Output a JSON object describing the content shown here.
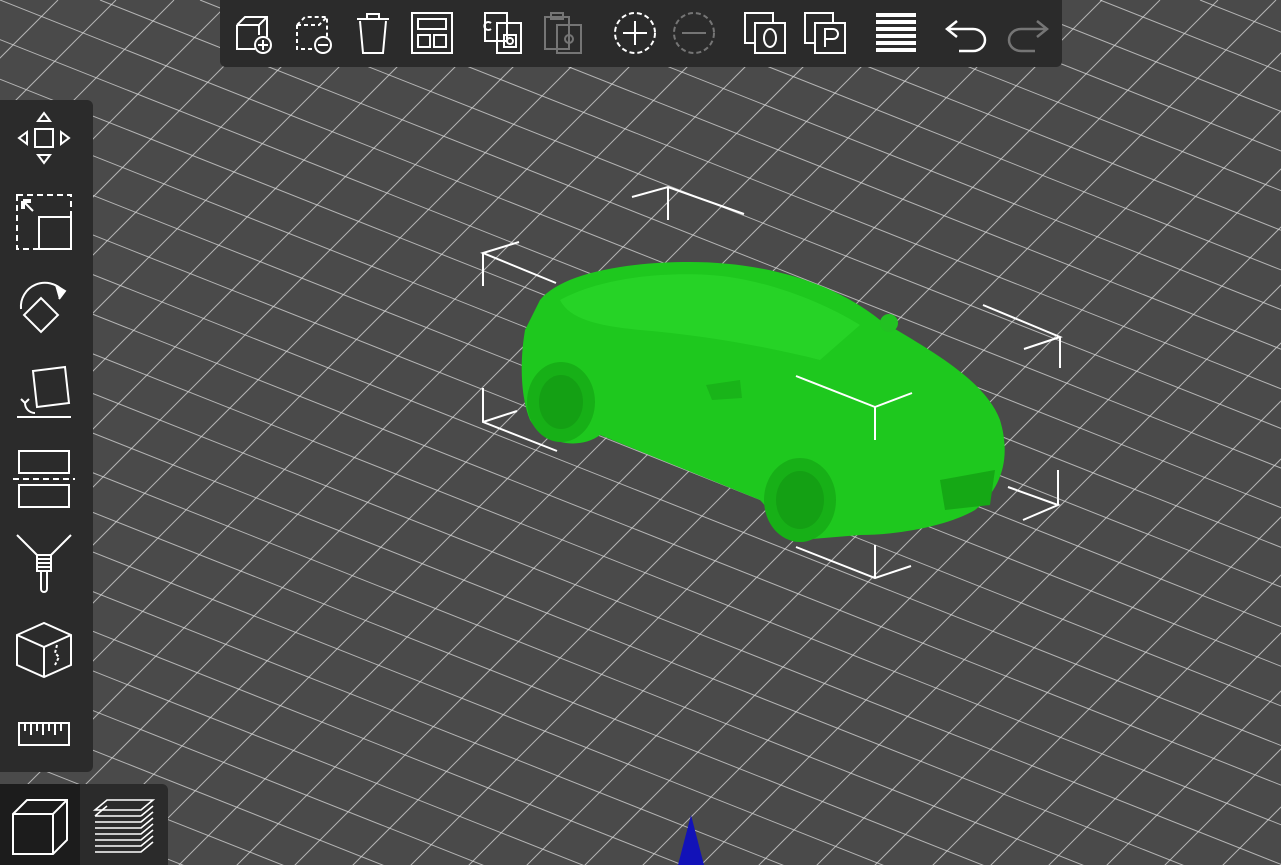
{
  "app": {
    "accent_model_color": "#1ec81e",
    "bed_color": "#4a4a4a",
    "grid_color": "#d8d8d8",
    "toolbar_bg": "#2b2b2b",
    "axis_marker_color": "#1212b8"
  },
  "top_toolbar": {
    "buttons": [
      {
        "icon": "add-object-icon",
        "enabled": true
      },
      {
        "icon": "remove-object-icon",
        "enabled": true
      },
      {
        "icon": "delete-icon",
        "enabled": true
      },
      {
        "icon": "arrange-icon",
        "enabled": true
      },
      {
        "icon": "copy-icon",
        "enabled": true
      },
      {
        "icon": "paste-icon",
        "enabled": false
      },
      {
        "icon": "add-instance-icon",
        "enabled": true
      },
      {
        "icon": "remove-instance-icon",
        "enabled": false
      },
      {
        "icon": "split-to-objects-icon",
        "enabled": true
      },
      {
        "icon": "split-to-parts-icon",
        "enabled": true
      },
      {
        "icon": "layers-editing-icon",
        "enabled": true
      },
      {
        "icon": "undo-icon",
        "enabled": true
      },
      {
        "icon": "redo-icon",
        "enabled": false
      }
    ]
  },
  "left_toolbar": {
    "tools": [
      {
        "icon": "move-icon"
      },
      {
        "icon": "scale-icon"
      },
      {
        "icon": "rotate-icon"
      },
      {
        "icon": "place-on-face-icon"
      },
      {
        "icon": "cut-icon"
      },
      {
        "icon": "paint-supports-icon"
      },
      {
        "icon": "seam-painting-icon"
      },
      {
        "icon": "measure-icon"
      }
    ]
  },
  "view_toggle": {
    "items": [
      {
        "icon": "3d-view-icon",
        "active": true
      },
      {
        "icon": "preview-layers-icon",
        "active": false
      }
    ]
  }
}
